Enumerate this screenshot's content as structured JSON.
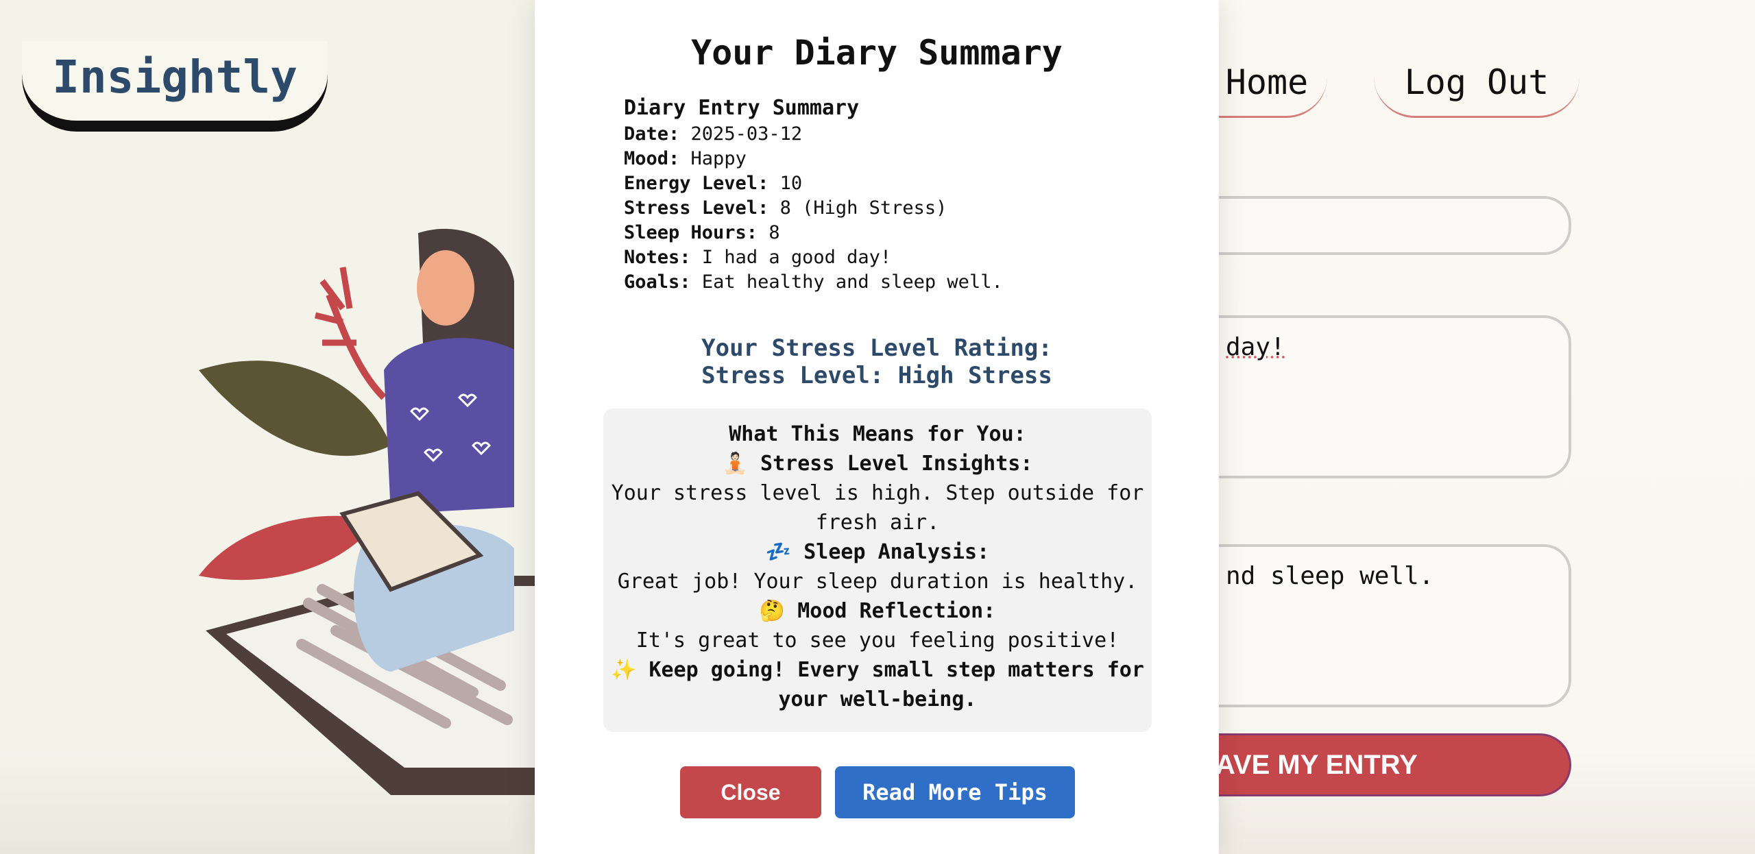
{
  "app": {
    "logo": "Insightly"
  },
  "nav": {
    "home": "Home",
    "logout": "Log Out"
  },
  "form": {
    "field_1_value": "",
    "notes_visible": "day!",
    "goals_visible": "nd sleep well.",
    "save_label": "AVE MY ENTRY"
  },
  "modal": {
    "title": "Your Diary Summary",
    "summary_title": "Diary Entry Summary",
    "date_label": "Date:",
    "date": "2025-03-12",
    "mood_label": "Mood:",
    "mood": "Happy",
    "energy_label": "Energy Level:",
    "energy": "10",
    "stress_label": "Stress Level:",
    "stress": "8 (High Stress)",
    "sleep_label": "Sleep Hours:",
    "sleep": "8",
    "notes_label": "Notes:",
    "notes": "I had a good day!",
    "goals_label": "Goals:",
    "goals": "Eat healthy and sleep well.",
    "rating_line1": "Your Stress Level Rating:",
    "rating_line2": "Stress Level: High Stress",
    "insights_title": "What This Means for You:",
    "stress_heading": "🧘🏻 Stress Level Insights:",
    "stress_text": "Your stress level is high. Step outside for fresh air.",
    "sleep_heading": "💤 Sleep Analysis:",
    "sleep_text": "Great job! Your sleep duration is healthy.",
    "mood_heading": "🤔 Mood Reflection:",
    "mood_text": "It's great to see you feeling positive!",
    "sparkle": "✨",
    "encourage_text": "Keep going! Every small step matters for your well-being.",
    "close_label": "Close",
    "tips_label": "Read More Tips"
  },
  "colors": {
    "accent_red": "#c4474b",
    "accent_blue": "#2f6fc7",
    "title_navy": "#2e4a6a",
    "background": "#f3f2e8"
  }
}
